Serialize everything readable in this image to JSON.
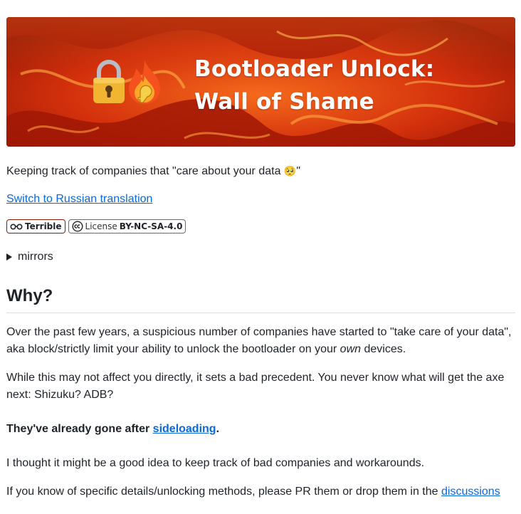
{
  "banner": {
    "title_line1": "Bootloader Unlock:",
    "title_line2": "Wall of Shame"
  },
  "tagline": {
    "text": "Keeping track of companies that \"care about your data ",
    "emoji": "🥺",
    "end": "\""
  },
  "translation_link": "Switch to Russian translation",
  "badges": {
    "rating_label": "Terrible",
    "license_prefix": "License",
    "license_value": "BY-NC-SA-4.0"
  },
  "details": {
    "summary": "mirrors"
  },
  "section": {
    "heading": "Why?",
    "p1_before": "Over the past few years, a suspicious number of companies have started to \"take care of your data\", aka block/strictly limit your ability to unlock the bootloader on your ",
    "p1_em": "own",
    "p1_after": " devices.",
    "p2": "While this may not affect you directly, it sets a bad precedent. You never know what will get the axe next: Shizuku? ADB?",
    "p3_before": "They've already gone after ",
    "p3_link": "sideloading",
    "p3_after": ".",
    "p4": "I thought it might be a good idea to keep track of bad companies and workarounds.",
    "p5_before": "If you know of specific details/unlocking methods, please PR them or drop them in the ",
    "p5_link": "discussions"
  },
  "colors": {
    "link": "#0969da",
    "banner_fire": "#d4320e",
    "badge_border": "#8a1a07"
  }
}
